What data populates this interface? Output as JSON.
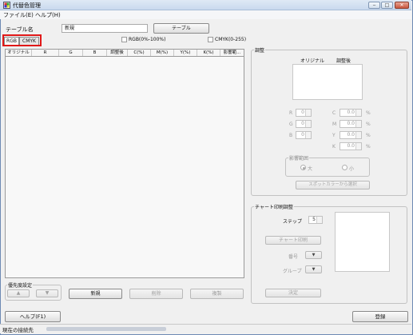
{
  "window": {
    "title": "代替色管理",
    "min_label": "‒",
    "max_label": "□",
    "close_label": "✕"
  },
  "menu": {
    "file": "ファイル(E)",
    "help": "ヘルプ(H)"
  },
  "table_name": {
    "label": "テーブル名",
    "value": "新規",
    "button": "テーブル"
  },
  "tabs": [
    "RGB",
    "CMYK"
  ],
  "checkboxes": {
    "rgb": "RGB(0%-100%)",
    "cmyk": "CMYK(0-255)"
  },
  "grid": {
    "columns": [
      "オリジナル",
      "R",
      "G",
      "B",
      "調整後",
      "C(%)",
      "M(%)",
      "Y(%)",
      "K(%)",
      "影響範..."
    ]
  },
  "priority": {
    "title": "優先度設定",
    "up": "▲",
    "down": "▼"
  },
  "actions": {
    "new": "新規",
    "delete": "削除",
    "copy": "複製"
  },
  "adjust": {
    "title": "調整",
    "original_label": "オリジナル",
    "adjusted_label": "調整後",
    "rgb_fields": [
      {
        "label": "R",
        "value": "0"
      },
      {
        "label": "G",
        "value": "0"
      },
      {
        "label": "B",
        "value": "0"
      }
    ],
    "cmyk_fields": [
      {
        "label": "C",
        "value": "0.0",
        "unit": "%"
      },
      {
        "label": "M",
        "value": "0.0",
        "unit": "%"
      },
      {
        "label": "Y",
        "value": "0.0",
        "unit": "%"
      },
      {
        "label": "K",
        "value": "0.0",
        "unit": "%"
      }
    ],
    "range_title": "影響範囲",
    "range_large": "大",
    "range_small": "小",
    "spot_button": "スポットカラーから選択"
  },
  "chart": {
    "title": "チャート印刷調整",
    "step_label": "ステップ",
    "step_value": "5",
    "print_button": "チャート印刷",
    "number_label": "番号",
    "group_label": "グループ",
    "decide_button": "決定"
  },
  "footer": {
    "help_button": "ヘルプ(F1)",
    "register_button": "登録",
    "status_label": "現在の接続先"
  }
}
